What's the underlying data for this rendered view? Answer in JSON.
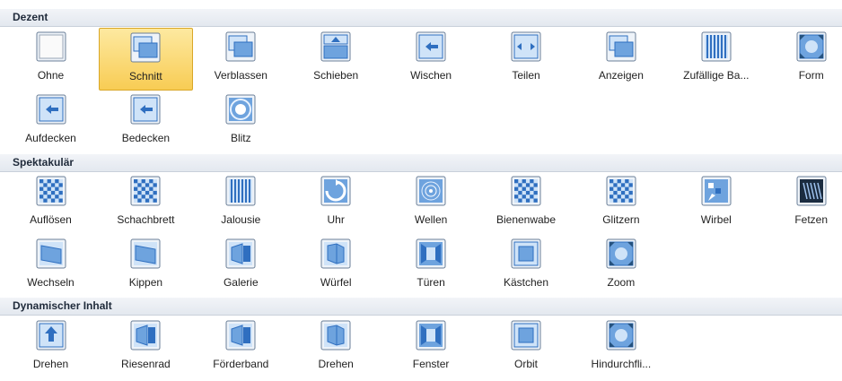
{
  "sections": [
    {
      "title": "Dezent",
      "rows": [
        [
          {
            "label": "Ohne",
            "icon": "none-icon"
          },
          {
            "label": "Schnitt",
            "icon": "cut-icon",
            "selected": true
          },
          {
            "label": "Verblassen",
            "icon": "fade-icon"
          },
          {
            "label": "Schieben",
            "icon": "push-icon"
          },
          {
            "label": "Wischen",
            "icon": "wipe-icon"
          },
          {
            "label": "Teilen",
            "icon": "split-icon"
          },
          {
            "label": "Anzeigen",
            "icon": "reveal-icon"
          },
          {
            "label": "Zufällige Ba...",
            "icon": "random-bars-icon"
          },
          {
            "label": "Form",
            "icon": "shape-icon"
          }
        ],
        [
          {
            "label": "Aufdecken",
            "icon": "uncover-icon"
          },
          {
            "label": "Bedecken",
            "icon": "cover-icon"
          },
          {
            "label": "Blitz",
            "icon": "flash-icon"
          }
        ]
      ]
    },
    {
      "title": "Spektakulär",
      "rows": [
        [
          {
            "label": "Auflösen",
            "icon": "dissolve-icon"
          },
          {
            "label": "Schachbrett",
            "icon": "checkerboard-icon"
          },
          {
            "label": "Jalousie",
            "icon": "blinds-icon"
          },
          {
            "label": "Uhr",
            "icon": "clock-icon"
          },
          {
            "label": "Wellen",
            "icon": "ripple-icon"
          },
          {
            "label": "Bienenwabe",
            "icon": "honeycomb-icon"
          },
          {
            "label": "Glitzern",
            "icon": "glitter-icon"
          },
          {
            "label": "Wirbel",
            "icon": "vortex-icon"
          },
          {
            "label": "Fetzen",
            "icon": "shred-icon"
          }
        ],
        [
          {
            "label": "Wechseln",
            "icon": "switch-icon"
          },
          {
            "label": "Kippen",
            "icon": "flip-icon"
          },
          {
            "label": "Galerie",
            "icon": "gallery-icon"
          },
          {
            "label": "Würfel",
            "icon": "cube-icon"
          },
          {
            "label": "Türen",
            "icon": "doors-icon"
          },
          {
            "label": "Kästchen",
            "icon": "box-icon"
          },
          {
            "label": "Zoom",
            "icon": "zoom-icon"
          }
        ]
      ]
    },
    {
      "title": "Dynamischer Inhalt",
      "rows": [
        [
          {
            "label": "Drehen",
            "icon": "pan-icon"
          },
          {
            "label": "Riesenrad",
            "icon": "ferris-wheel-icon"
          },
          {
            "label": "Förderband",
            "icon": "conveyor-icon"
          },
          {
            "label": "Drehen",
            "icon": "rotate-icon"
          },
          {
            "label": "Fenster",
            "icon": "window-icon"
          },
          {
            "label": "Orbit",
            "icon": "orbit-icon"
          },
          {
            "label": "Hindurchfli...",
            "icon": "fly-through-icon"
          }
        ]
      ]
    }
  ],
  "colors": {
    "selected_fill": "#f8cc54",
    "selected_border": "#d9a728",
    "thumb_blue": "#2f6fc0",
    "thumb_light": "#cfe3f8"
  }
}
